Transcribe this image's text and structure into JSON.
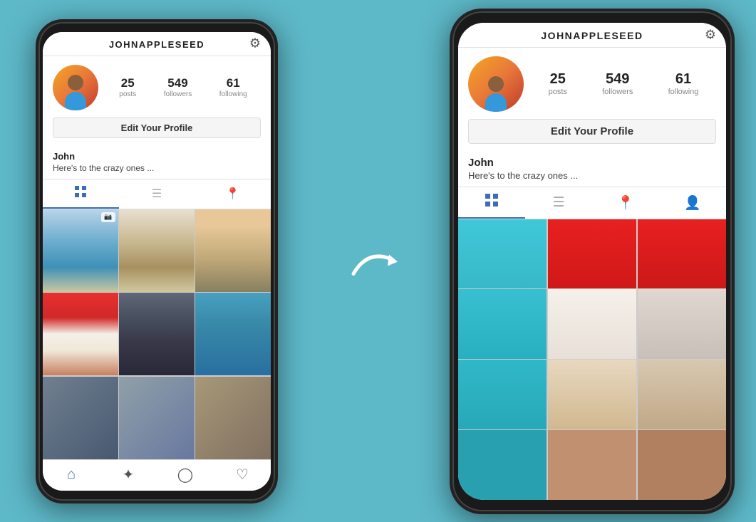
{
  "left_phone": {
    "header": {
      "title": "JOHNAPPLESEED"
    },
    "profile": {
      "stats": [
        {
          "number": "25",
          "label": "posts"
        },
        {
          "number": "549",
          "label": "followers"
        },
        {
          "number": "61",
          "label": "following"
        }
      ],
      "edit_button": "Edit Your Profile",
      "name": "John",
      "bio": "Here's to the crazy ones ..."
    },
    "tabs": [
      "grid",
      "list",
      "location"
    ]
  },
  "right_phone": {
    "header": {
      "title": "JOHNAPPLESEED"
    },
    "profile": {
      "stats": [
        {
          "number": "25",
          "label": "posts"
        },
        {
          "number": "549",
          "label": "followers"
        },
        {
          "number": "61",
          "label": "following"
        }
      ],
      "edit_button": "Edit Your Profile",
      "name": "John",
      "bio": "Here's to the crazy ones ..."
    },
    "tabs": [
      "grid",
      "list",
      "location",
      "person"
    ]
  },
  "arrow": "→",
  "background_color": "#5db8c8"
}
